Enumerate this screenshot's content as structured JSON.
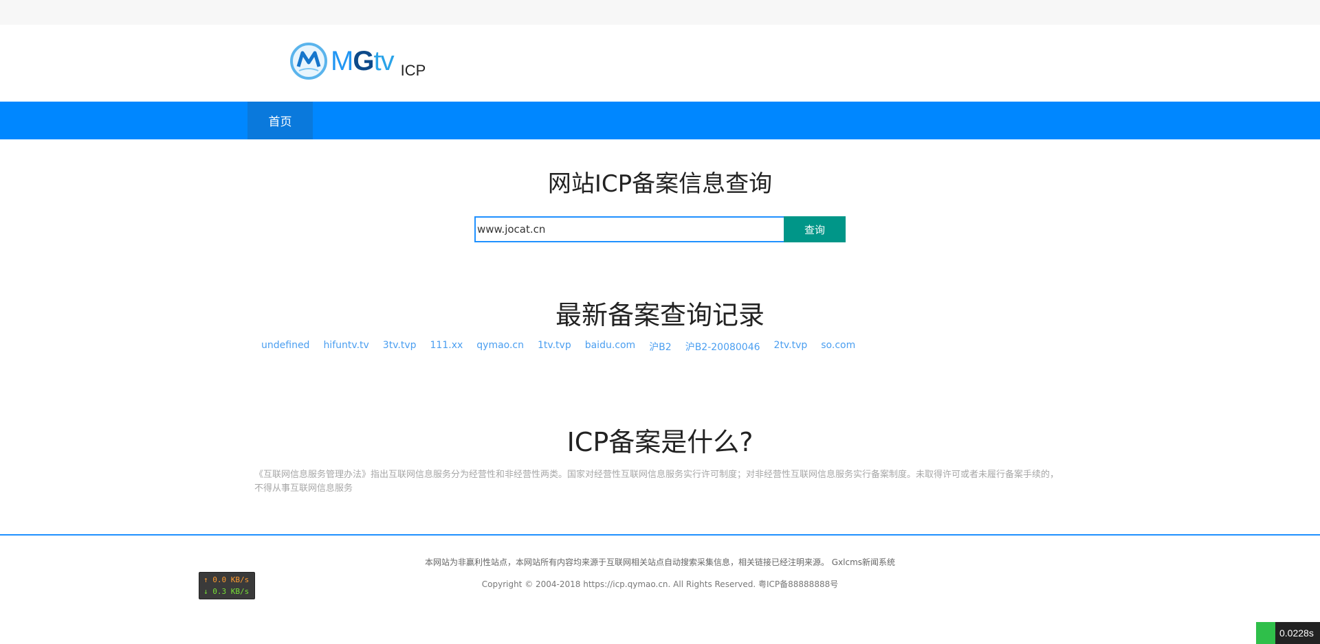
{
  "logo": {
    "brand_m": "M",
    "brand_g": "G",
    "brand_tv": "tv",
    "suffix": "ICP"
  },
  "nav": {
    "home": "首页"
  },
  "search": {
    "title": "网站ICP备案信息查询",
    "value": "www.jocat.cn",
    "button": "查询"
  },
  "recent": {
    "title": "最新备案查询记录",
    "items": [
      "undefined",
      "hifuntv.tv",
      "3tv.tvp",
      "111.xx",
      "qymao.cn",
      "1tv.tvp",
      "baidu.com",
      "沪B2",
      "沪B2-20080046",
      "2tv.tvp",
      "so.com"
    ]
  },
  "about": {
    "title": "ICP备案是什么?",
    "text": "《互联网信息服务管理办法》指出互联网信息服务分为经营性和非经营性两类。国家对经营性互联网信息服务实行许可制度；对非经营性互联网信息服务实行备案制度。未取得许可或者未履行备案手续的，不得从事互联网信息服务"
  },
  "footer": {
    "line1": "本网站为非赢利性站点，本网站所有内容均来源于互联网相关站点自动搜索采集信息，相关链接已经注明来源。  Gxlcms新闻系统",
    "line2": "Copyright © 2004-2018 https://icp.qymao.cn. All Rights Reserved.   粤ICP备88888888号"
  },
  "netspeed": {
    "up": "↑ 0.0 KB/s",
    "down": "↓ 0.3 KB/s"
  },
  "timer": {
    "value": "0.0228s"
  },
  "colors": {
    "nav": "#0087ff",
    "button": "#009688",
    "link": "#4a9ef0"
  }
}
